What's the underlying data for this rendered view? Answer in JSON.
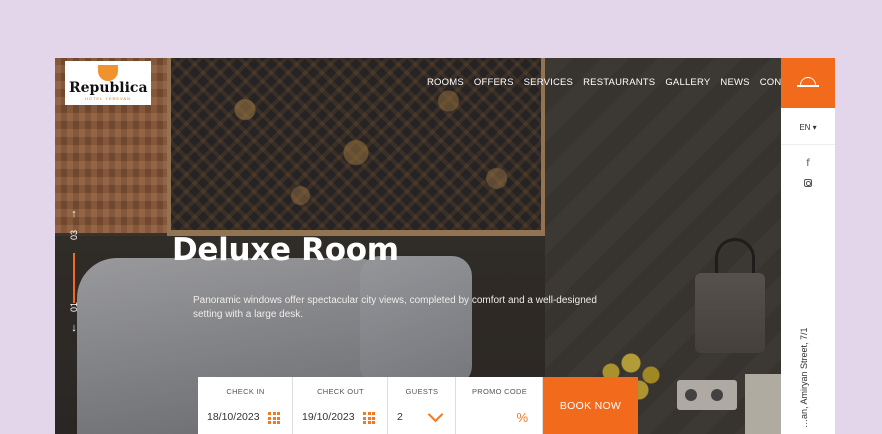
{
  "logo": {
    "name": "Republica",
    "sub": "HOTEL YEREVAN"
  },
  "nav": [
    "ROOMS",
    "OFFERS",
    "SERVICES",
    "RESTAURANTS",
    "GALLERY",
    "NEWS",
    "CONTACTS"
  ],
  "slider": {
    "current": "01",
    "total": "03",
    "up_arrow": "↑",
    "down_arrow": "↓"
  },
  "hero": {
    "title": "Deluxe Room",
    "description": "Panoramic windows offer spectacular city views, completed by comfort and a well-designed setting with a large desk."
  },
  "booking": {
    "check_in": {
      "label": "CHECK IN",
      "value": "18/10/2023"
    },
    "check_out": {
      "label": "CHECK OUT",
      "value": "19/10/2023"
    },
    "guests": {
      "label": "GUESTS",
      "value": "2"
    },
    "promo": {
      "label": "PROMO CODE",
      "value": "",
      "icon_text": "%"
    },
    "button": "BOOK NOW"
  },
  "sidebar": {
    "language": "EN ▾",
    "facebook": "f",
    "address": "…an, Amiryan Street, 7/1"
  },
  "colors": {
    "accent": "#f26a1b",
    "background": "#e3d6ea",
    "sidebar": "#ffffff"
  },
  "icons": [
    "bell-icon",
    "calendar-icon",
    "chevron-down-icon",
    "percent-icon",
    "facebook-icon",
    "instagram-icon",
    "arrow-up-icon",
    "arrow-down-icon"
  ]
}
